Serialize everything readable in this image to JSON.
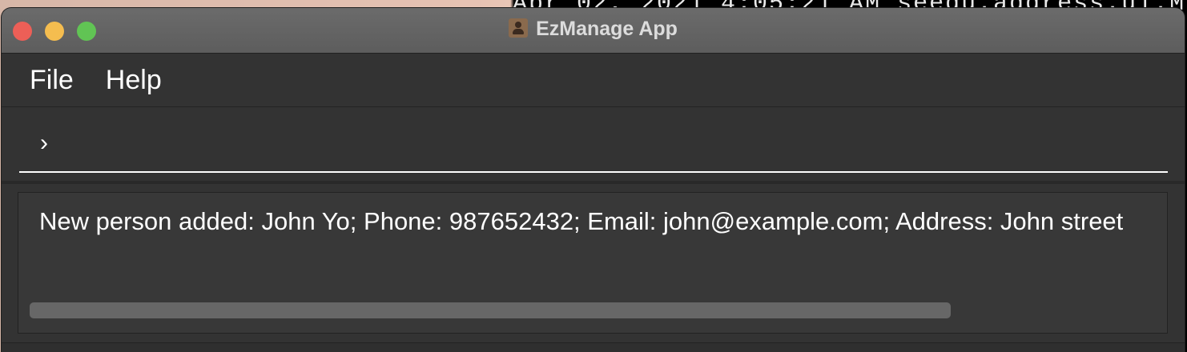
{
  "background": {
    "terminal_text": "Apr 02, 2021 4:05:21 AM seedu.address.ui.M"
  },
  "window": {
    "title": "EzManage App",
    "accent_colors": {
      "close": "#ed5f57",
      "minimize": "#f5bd4f",
      "maximize": "#61c454"
    }
  },
  "menu": {
    "items": [
      {
        "label": "File"
      },
      {
        "label": "Help"
      }
    ]
  },
  "command": {
    "prompt": "›",
    "value": "",
    "placeholder": ""
  },
  "result": {
    "text": "New person added: John Yo; Phone: 987652432; Email: john@example.com; Address: John street"
  },
  "icons": {
    "app": "app-icon",
    "close": "close-icon",
    "minimize": "minimize-icon",
    "maximize": "maximize-icon"
  }
}
